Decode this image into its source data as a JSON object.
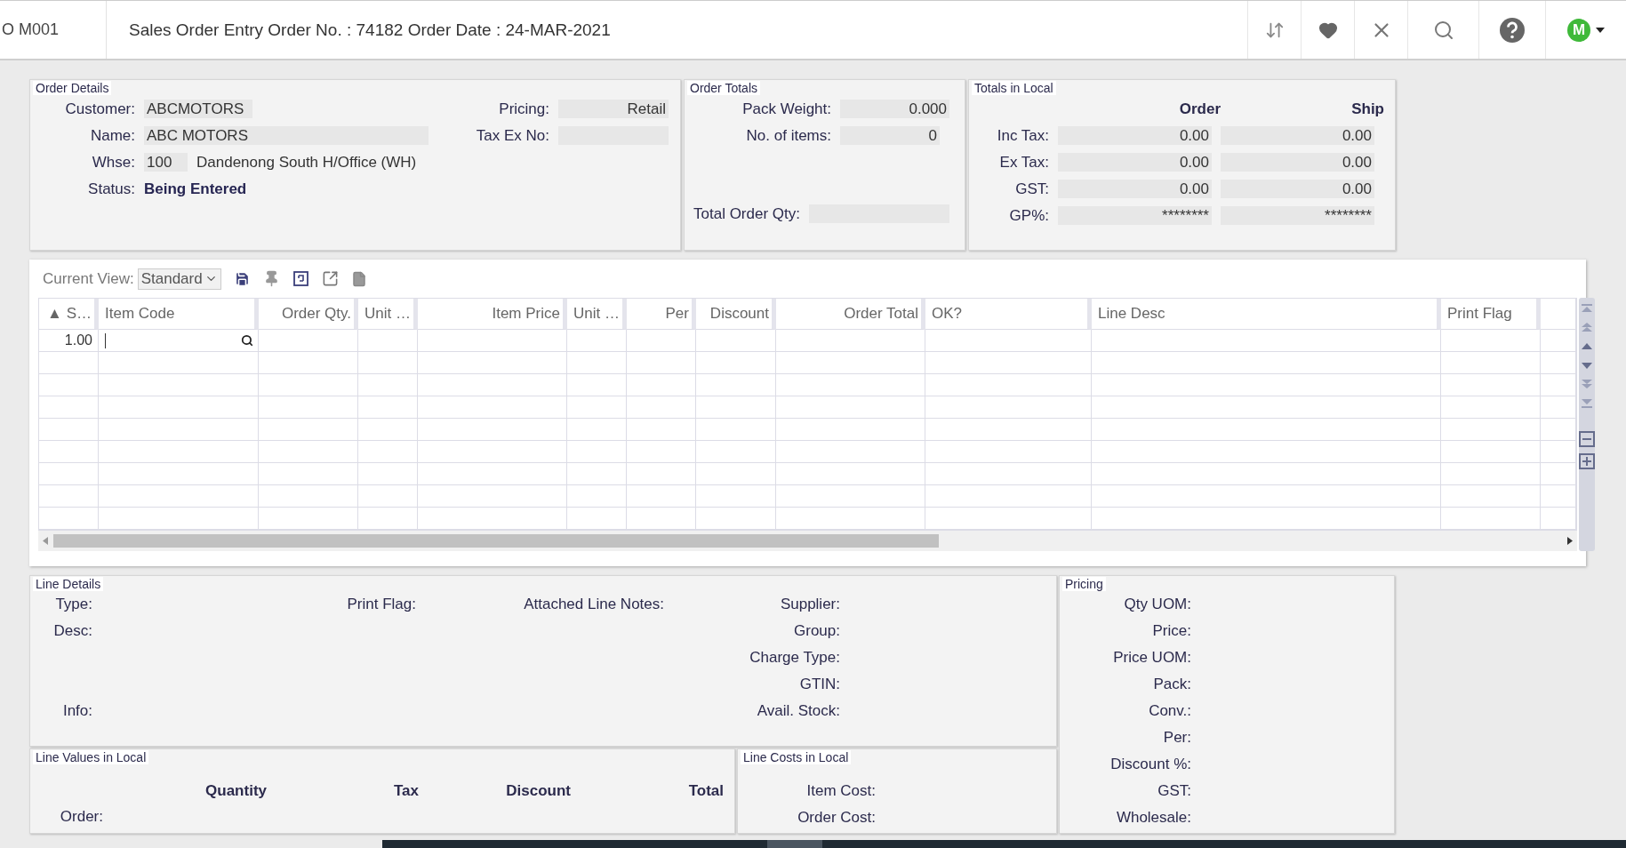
{
  "header": {
    "module": "O M001",
    "title": "Sales Order Entry Order No. : 74182 Order Date : 24-MAR-2021",
    "avatar": "M"
  },
  "order_details": {
    "title": "Order Details",
    "left": [
      {
        "label": "Customer:",
        "value": "ABCMOTORS",
        "kind": "short-box"
      },
      {
        "label": "Name:",
        "value": "ABC MOTORS",
        "kind": "wide-box"
      },
      {
        "label": "Whse:",
        "value": "100",
        "extra": "Dandenong South H/Office (WH)",
        "kind": "code-box"
      },
      {
        "label": "Status:",
        "value": "Being Entered",
        "kind": "status"
      }
    ],
    "right": [
      {
        "label": "Pricing:",
        "value": "Retail",
        "kind": "right-box"
      },
      {
        "label": "Tax Ex No:",
        "kind": "right-box"
      }
    ]
  },
  "order_totals": {
    "title": "Order Totals",
    "fields": [
      {
        "label": "Pack Weight:",
        "value": "0.000"
      },
      {
        "label": "No. of items:",
        "value": "0"
      }
    ],
    "total": {
      "label": "Total Order Qty:"
    }
  },
  "totals_local": {
    "title": "Totals in Local",
    "columns": [
      "Order",
      "Ship"
    ],
    "rows": [
      {
        "label": "Inc Tax:",
        "values": [
          "0.00",
          "0.00"
        ]
      },
      {
        "label": "Ex Tax:",
        "values": [
          "0.00",
          "0.00"
        ]
      },
      {
        "label": "GST:",
        "values": [
          "0.00",
          "0.00"
        ]
      },
      {
        "label": "GP%:",
        "values": [
          "********",
          "********"
        ]
      }
    ]
  },
  "grid": {
    "view_label": "Current View:",
    "view": "Standard",
    "columns": [
      {
        "label": "▲ S…"
      },
      {
        "label": "Item Code"
      },
      {
        "label": "Order Qty."
      },
      {
        "label": "Unit …"
      },
      {
        "label": "Item Price"
      },
      {
        "label": "Unit …"
      },
      {
        "label": "Per"
      },
      {
        "label": "Discount"
      },
      {
        "label": "Order Total"
      },
      {
        "label": "OK?"
      },
      {
        "label": "Line Desc"
      },
      {
        "label": "Print Flag"
      }
    ],
    "rows": [
      {
        "sequence": "1.00",
        "editing": true
      }
    ]
  },
  "line_details": {
    "title": "Line Details",
    "columns": [
      [
        "Type:",
        "Desc:"
      ],
      [
        "Print Flag:"
      ],
      [
        "Attached Line Notes:"
      ],
      [
        "Supplier:",
        "Group:",
        "Charge Type:",
        "GTIN:",
        "Avail. Stock:"
      ]
    ],
    "info_label": "Info:"
  },
  "line_values": {
    "title": "Line Values in Local",
    "columns": [
      "Quantity",
      "Tax",
      "Discount",
      "Total"
    ],
    "row_label": "Order:"
  },
  "line_costs": {
    "title": "Line Costs in Local",
    "labels": [
      "Item Cost:",
      "Order Cost:"
    ]
  },
  "pricing": {
    "title": "Pricing",
    "labels": [
      "Qty UOM:",
      "Price:",
      "Price UOM:",
      "Pack:",
      "Conv.:",
      "Per:",
      "Discount %:",
      "GST:",
      "Wholesale:"
    ]
  }
}
